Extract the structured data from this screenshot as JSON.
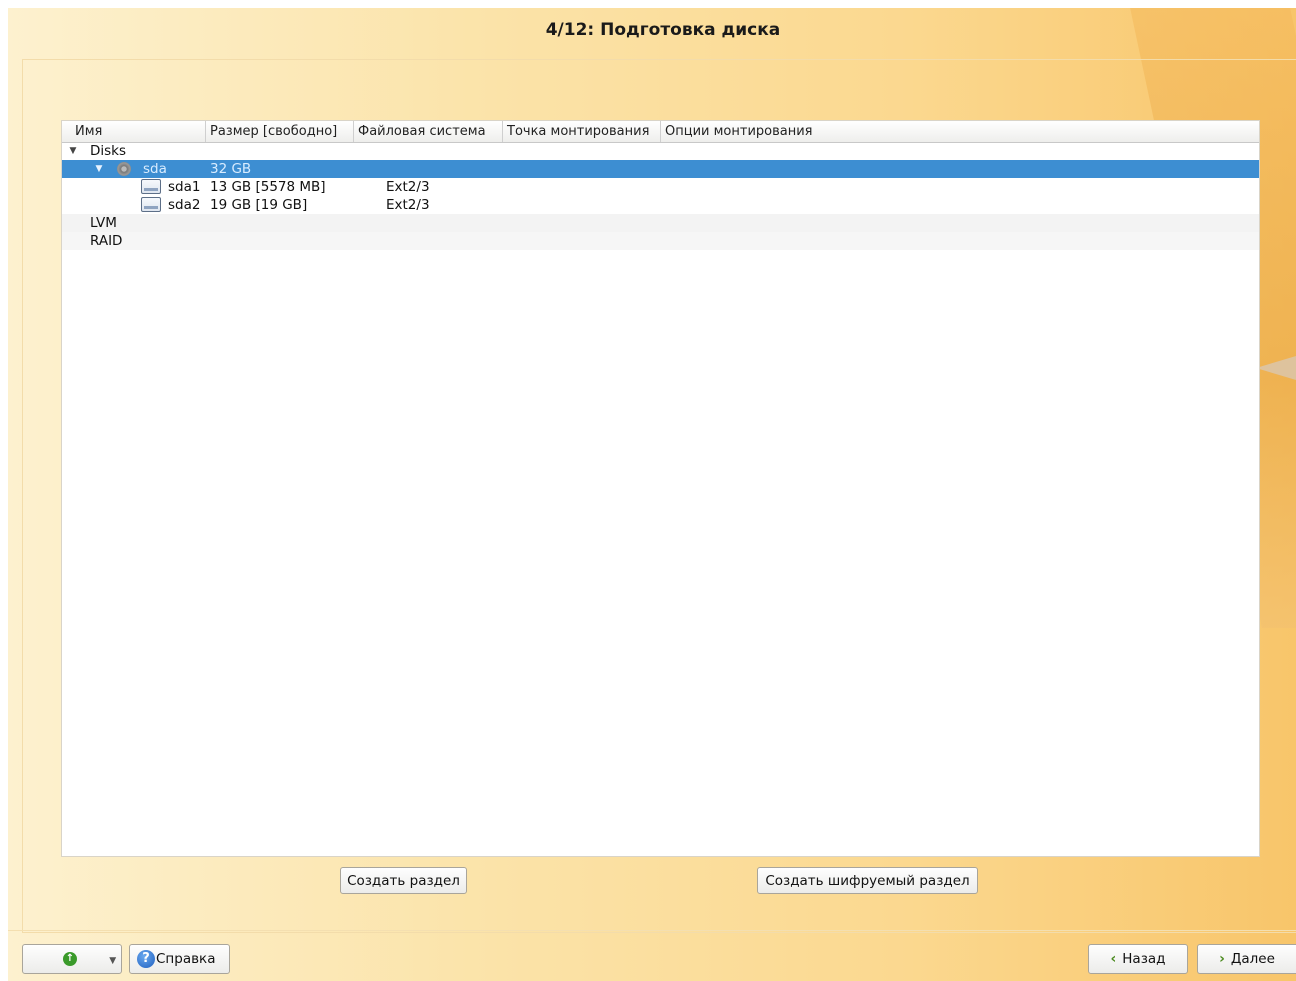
{
  "window": {
    "title": "4/12: Подготовка диска"
  },
  "table": {
    "columns": [
      "Имя",
      "Размер [свободно]",
      "Файловая система",
      "Точка монтирования",
      "Опции монтирования"
    ],
    "rows": [
      {
        "name": "Disks",
        "size": "",
        "fs": "",
        "mount": "",
        "options": ""
      },
      {
        "name": "sda",
        "size": "32 GB",
        "fs": "",
        "mount": "",
        "options": "",
        "selected": true
      },
      {
        "name": "sda1",
        "size": "13 GB [5578 MB]",
        "fs": "Ext2/3",
        "mount": "",
        "options": ""
      },
      {
        "name": "sda2",
        "size": "19 GB [19 GB]",
        "fs": "Ext2/3",
        "mount": "",
        "options": ""
      },
      {
        "name": "LVM",
        "size": "",
        "fs": "",
        "mount": "",
        "options": ""
      },
      {
        "name": "RAID",
        "size": "",
        "fs": "",
        "mount": "",
        "options": ""
      }
    ]
  },
  "actions": {
    "create_partition": "Создать раздел",
    "create_encrypted_partition": "Создать шифруемый раздел"
  },
  "footer": {
    "help_label": "Справка",
    "back_label": "Назад",
    "next_label": "Далее"
  },
  "icons": {
    "expand": "triangle-down-icon",
    "disk": "hard-disk-icon",
    "partition": "partition-icon",
    "go": "green-circle-arrow-icon",
    "help": "help-icon"
  },
  "colors": {
    "selection": "#3d8ed2",
    "background_warm": "#fbd88f"
  }
}
